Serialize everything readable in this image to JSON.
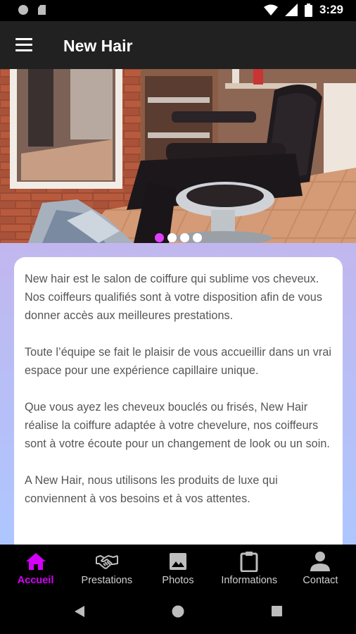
{
  "status_bar": {
    "time": "3:29"
  },
  "app_bar": {
    "title": "New Hair"
  },
  "carousel": {
    "slides": 4,
    "active_index": 0,
    "active_color": "#e040fb"
  },
  "content": {
    "paragraphs": [
      "New hair est le salon de coiffure qui sublime vos cheveux. Nos coiffeurs qualifiés sont à votre disposition afin de vous donner accès aux meilleures prestations.",
      "Toute l’équipe se fait le plaisir de vous accueillir dans un vrai espace pour une expérience capillaire unique.",
      "Que vous ayez les cheveux bouclés ou frisés, New Hair réalise la coiffure adaptée à votre chevelure, nos coiffeurs sont à votre écoute pour un changement de look ou un soin.",
      "A New Hair, nous utilisons les produits de luxe qui conviennent à vos besoins et à vos attentes."
    ]
  },
  "bottom_nav": {
    "items": [
      {
        "label": "Accueil",
        "icon": "home-icon",
        "active": true
      },
      {
        "label": "Prestations",
        "icon": "handshake-icon",
        "active": false
      },
      {
        "label": "Photos",
        "icon": "image-icon",
        "active": false
      },
      {
        "label": "Informations",
        "icon": "clipboard-icon",
        "active": false
      },
      {
        "label": "Contact",
        "icon": "person-icon",
        "active": false
      }
    ],
    "active_color": "#d500f9"
  }
}
